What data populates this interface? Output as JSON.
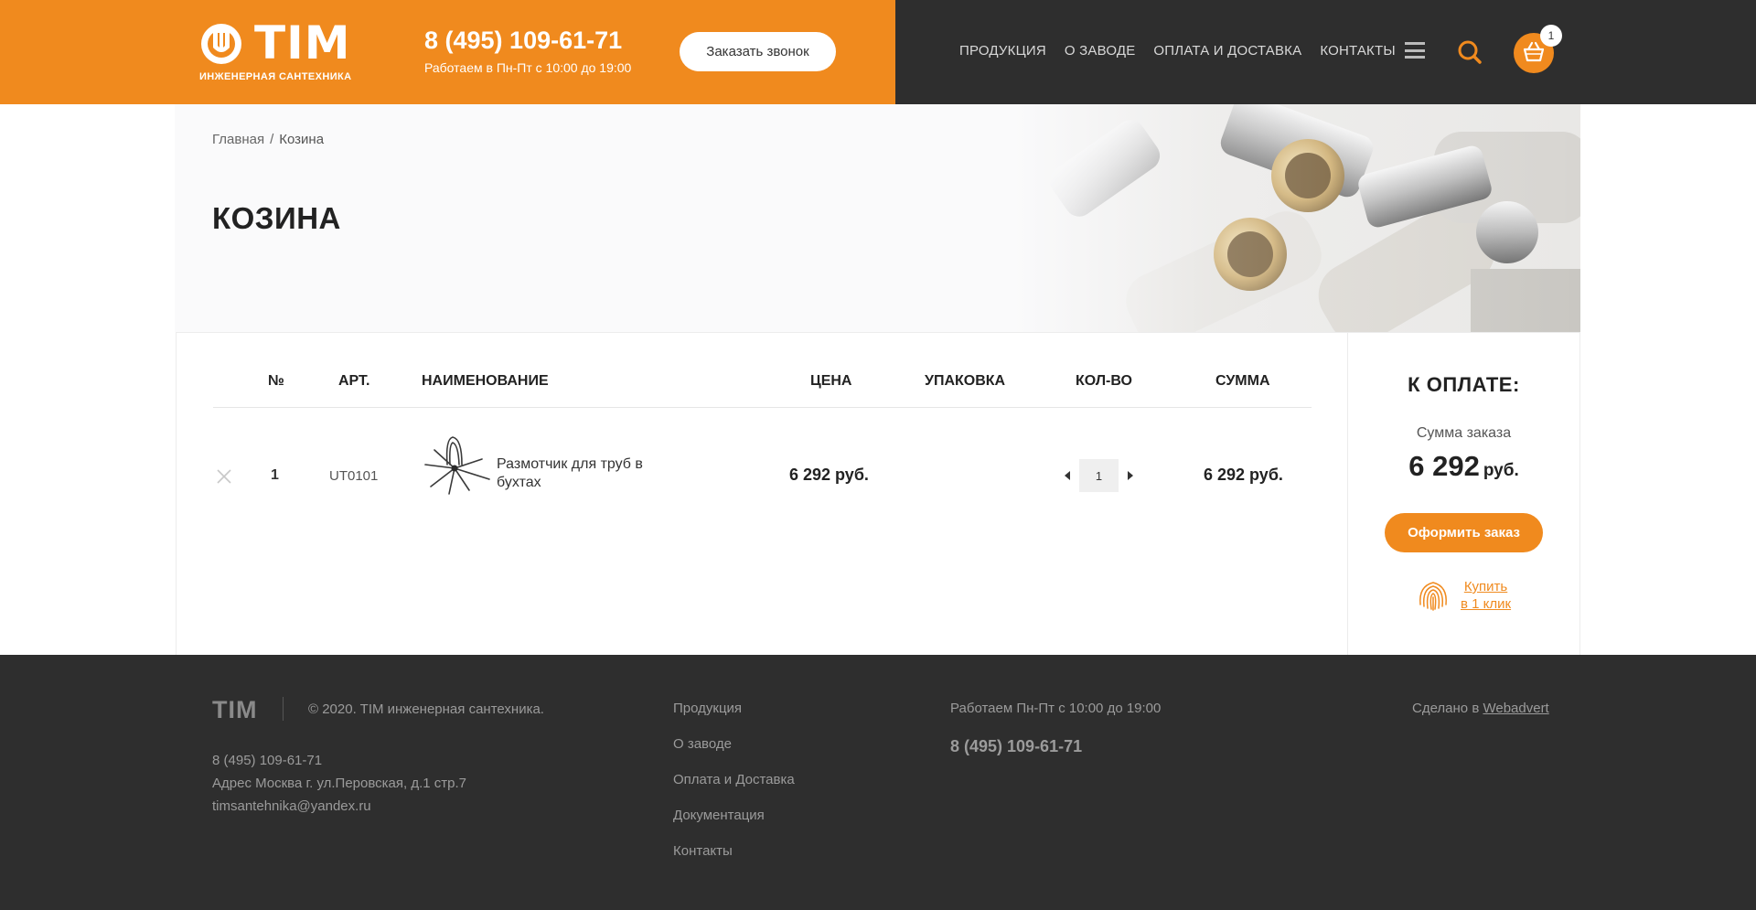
{
  "header": {
    "logo_text": "TIM",
    "logo_sub": "ИНЖЕНЕРНАЯ САНТЕХНИКА",
    "phone": "8 (495) 109-61-71",
    "hours": "Работаем в Пн-Пт с 10:00 до 19:00",
    "call_button": "Заказать звонок",
    "nav": [
      "ПРОДУКЦИЯ",
      "О ЗАВОДЕ",
      "ОПЛАТА И ДОСТАВКА",
      "КОНТАКТЫ"
    ],
    "cart_count": "1"
  },
  "breadcrumb": {
    "home": "Главная",
    "separator": "/",
    "current": "Козина"
  },
  "page_title": "КОЗИНА",
  "table": {
    "headers": {
      "num": "№",
      "art": "АРТ.",
      "name": "НАИМЕНОВАНИЕ",
      "price": "ЦЕНА",
      "pack": "УПАКОВКА",
      "qty": "КОЛ-ВО",
      "sum": "СУММА"
    },
    "rows": [
      {
        "num": "1",
        "art": "UT0101",
        "name_line1": "Размотчик для труб в",
        "name_line2": "бухтах",
        "price": "6 292 руб.",
        "pack": "",
        "qty": "1",
        "sum": "6 292 руб."
      }
    ]
  },
  "summary": {
    "title": "К ОПЛАТЕ:",
    "label": "Сумма заказа",
    "amount": "6 292",
    "currency": "руб.",
    "order_button": "Оформить заказ",
    "one_click_line1": "Купить",
    "one_click_line2": "в 1 клик"
  },
  "footer": {
    "logo": "TIM",
    "copyright": "© 2020. TIM инженерная сантехника.",
    "phone": "8 (495) 109-61-71",
    "address": "Адрес Москва г.  ул.Перовская, д.1 стр.7",
    "email": "timsantehnika@yandex.ru",
    "menu": [
      "Продукция",
      "О заводе",
      "Оплата и Доставка",
      "Документация",
      "Контакты"
    ],
    "hours": "Работаем Пн-Пт с 10:00 до 19:00",
    "phone_big": "8 (495) 109-61-71",
    "made_prefix": "Сделано в ",
    "made_link": "Webadvert"
  },
  "colors": {
    "accent": "#f08a1e",
    "dark": "#2e2e2e"
  }
}
